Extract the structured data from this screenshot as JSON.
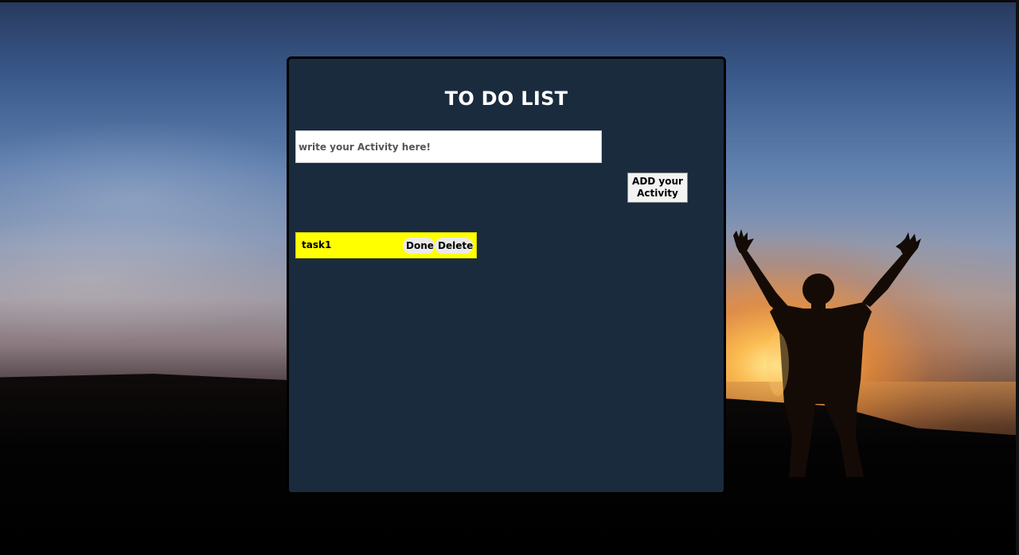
{
  "app": {
    "title": "TO DO LIST"
  },
  "form": {
    "input_placeholder": "write your Activity here!",
    "input_value": "",
    "add_button_label": "ADD your Activity"
  },
  "tasks": [
    {
      "text": "task1",
      "done_label": "Done",
      "delete_label": "Delete"
    }
  ],
  "colors": {
    "panel_background": "#1a2b3e",
    "task_background": "#ffff00",
    "title_text": "#ffffff"
  },
  "icons": {
    "background": "sunset-silhouette-image"
  }
}
